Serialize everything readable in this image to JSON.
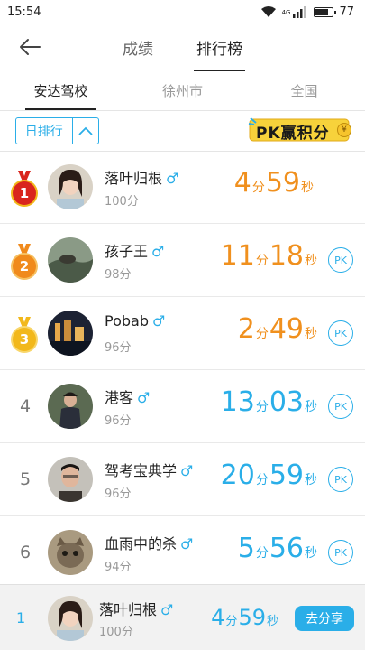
{
  "status_bar": {
    "time": "15:54",
    "network": "4G",
    "battery": "77",
    "battery_level": 0.77
  },
  "nav": {
    "tabs": [
      {
        "label": "成绩",
        "active": false
      },
      {
        "label": "排行榜",
        "active": true
      }
    ]
  },
  "sub_tabs": [
    {
      "label": "安达驾校",
      "active": true
    },
    {
      "label": "徐州市",
      "active": false
    },
    {
      "label": "全国",
      "active": false
    }
  ],
  "filter": {
    "label": "日排行"
  },
  "pk_banner": {
    "text": "PK赢积分",
    "coin": "¥"
  },
  "colors": {
    "accent_blue": "#2aaee8",
    "orange": "#f0901e",
    "medal_gold": "#f2b81b",
    "medal_red": "#d9251d",
    "medal_orange": "#f08a1c"
  },
  "leaderboard": [
    {
      "rank": "1",
      "name": "落叶归根",
      "gender": "♂",
      "score": "100分",
      "minutes": "4",
      "min_unit": "分",
      "seconds": "59",
      "sec_unit": "秒",
      "pk": ""
    },
    {
      "rank": "2",
      "name": "孩子王",
      "gender": "♂",
      "score": "98分",
      "minutes": "11",
      "min_unit": "分",
      "seconds": "18",
      "sec_unit": "秒",
      "pk": "PK"
    },
    {
      "rank": "3",
      "name": "Pobab",
      "gender": "♂",
      "score": "96分",
      "minutes": "2",
      "min_unit": "分",
      "seconds": "49",
      "sec_unit": "秒",
      "pk": "PK"
    },
    {
      "rank": "4",
      "name": "港客",
      "gender": "♂",
      "score": "96分",
      "minutes": "13",
      "min_unit": "分",
      "seconds": "03",
      "sec_unit": "秒",
      "pk": "PK"
    },
    {
      "rank": "5",
      "name": "驾考宝典学",
      "gender": "♂",
      "score": "96分",
      "minutes": "20",
      "min_unit": "分",
      "seconds": "59",
      "sec_unit": "秒",
      "pk": "PK"
    },
    {
      "rank": "6",
      "name": "血雨中的杀",
      "gender": "♂",
      "score": "94分",
      "minutes": "5",
      "min_unit": "分",
      "seconds": "56",
      "sec_unit": "秒",
      "pk": "PK"
    }
  ],
  "footer": {
    "rank": "1",
    "name": "落叶归根",
    "gender": "♂",
    "score": "100分",
    "minutes": "4",
    "min_unit": "分",
    "seconds": "59",
    "sec_unit": "秒",
    "share_label": "去分享"
  }
}
